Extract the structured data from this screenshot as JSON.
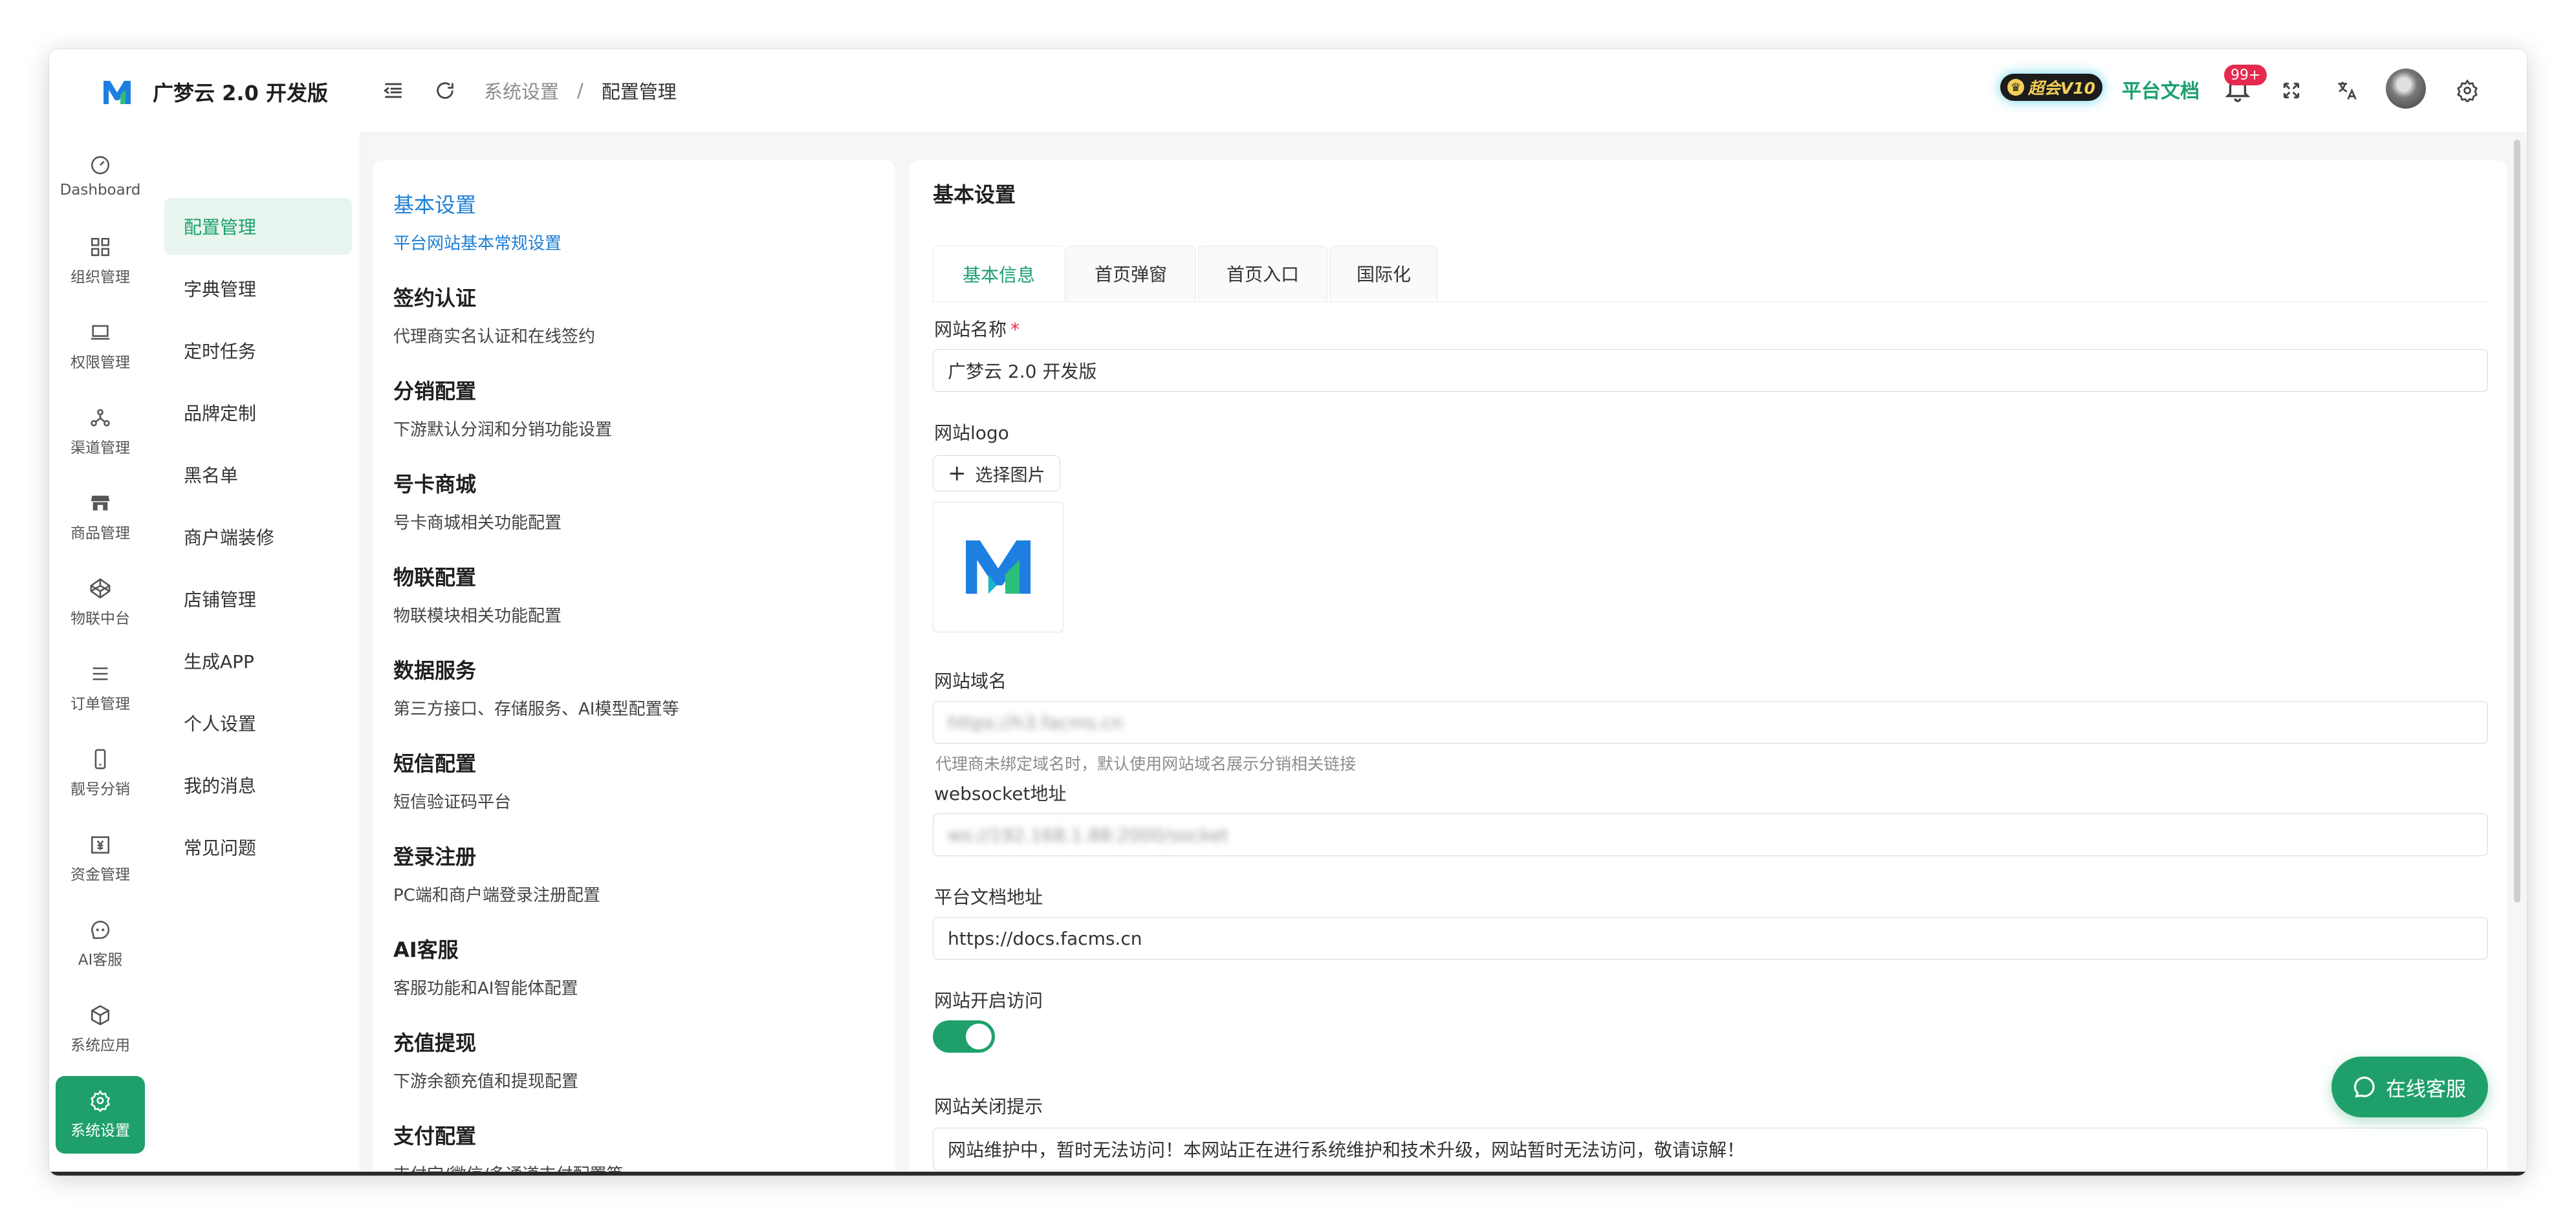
{
  "app": {
    "brand_name": "广梦云 2.0 开发版",
    "brand_color": "#1fa06b"
  },
  "header": {
    "breadcrumb": [
      "系统设置",
      "配置管理"
    ],
    "breadcrumb_sep": "/",
    "vip_badge": "超会V10",
    "docs_link": "平台文档",
    "notif_count": "99+",
    "icons": [
      "menu-fold-icon",
      "refresh-icon",
      "bell-icon",
      "fullscreen-icon",
      "translate-icon",
      "gear-icon"
    ]
  },
  "nav_primary": [
    {
      "label": "Dashboard",
      "icon": "dashboard-icon"
    },
    {
      "label": "组织管理",
      "icon": "grid-icon"
    },
    {
      "label": "权限管理",
      "icon": "laptop-icon"
    },
    {
      "label": "渠道管理",
      "icon": "nodes-icon"
    },
    {
      "label": "商品管理",
      "icon": "shop-icon"
    },
    {
      "label": "物联中台",
      "icon": "codepen-icon"
    },
    {
      "label": "订单管理",
      "icon": "list-icon"
    },
    {
      "label": "靓号分销",
      "icon": "mobile-icon"
    },
    {
      "label": "资金管理",
      "icon": "money-icon"
    },
    {
      "label": "AI客服",
      "icon": "chat-icon"
    },
    {
      "label": "系统应用",
      "icon": "box-icon"
    },
    {
      "label": "系统设置",
      "icon": "gear-icon",
      "active": true
    }
  ],
  "nav_secondary": [
    {
      "label": "配置管理",
      "active": true
    },
    {
      "label": "字典管理"
    },
    {
      "label": "定时任务"
    },
    {
      "label": "品牌定制"
    },
    {
      "label": "黑名单"
    },
    {
      "label": "商户端装修"
    },
    {
      "label": "店铺管理"
    },
    {
      "label": "生成APP"
    },
    {
      "label": "个人设置"
    },
    {
      "label": "我的消息"
    },
    {
      "label": "常见问题"
    }
  ],
  "categories": [
    {
      "title": "基本设置",
      "desc": "平台网站基本常规设置",
      "active": true
    },
    {
      "title": "签约认证",
      "desc": "代理商实名认证和在线签约"
    },
    {
      "title": "分销配置",
      "desc": "下游默认分润和分销功能设置"
    },
    {
      "title": "号卡商城",
      "desc": "号卡商城相关功能配置"
    },
    {
      "title": "物联配置",
      "desc": "物联模块相关功能配置"
    },
    {
      "title": "数据服务",
      "desc": "第三方接口、存储服务、AI模型配置等"
    },
    {
      "title": "短信配置",
      "desc": "短信验证码平台"
    },
    {
      "title": "登录注册",
      "desc": "PC端和商户端登录注册配置"
    },
    {
      "title": "AI客服",
      "desc": "客服功能和AI智能体配置"
    },
    {
      "title": "充值提现",
      "desc": "下游余额充值和提现配置"
    },
    {
      "title": "支付配置",
      "desc": "支付宝/微信/多通道支付配置等"
    }
  ],
  "form": {
    "title": "基本设置",
    "tabs": [
      "基本信息",
      "首页弹窗",
      "首页入口",
      "国际化"
    ],
    "site_name_label": "网站名称",
    "required_mark": "*",
    "site_name_value": "广梦云 2.0 开发版",
    "site_logo_label": "网站logo",
    "choose_image": "选择图片",
    "site_domain_label": "网站域名",
    "site_domain_value": "https://h3.facms.cn",
    "site_domain_help": "代理商未绑定域名时，默认使用网站域名展示分销相关链接",
    "ws_label": "websocket地址",
    "ws_value": "ws://192.168.1.88:2000/socket",
    "docs_label": "平台文档地址",
    "docs_value": "https://docs.facms.cn",
    "open_access_label": "网站开启访问",
    "open_access_on": true,
    "close_tip_label": "网站关闭提示",
    "close_tip_value": "网站维护中，暂时无法访问！本网站正在进行系统维护和技术升级，网站暂时无法访问，敬请谅解！"
  },
  "support_button": "在线客服"
}
